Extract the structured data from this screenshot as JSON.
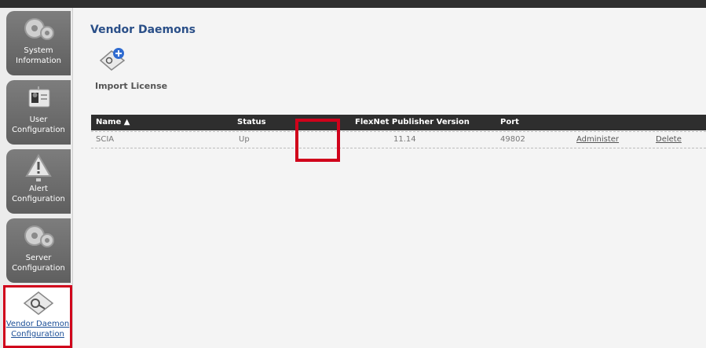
{
  "sidebar": {
    "items": [
      {
        "label": "System Information",
        "icon": "gears-icon"
      },
      {
        "label": "User Configuration",
        "icon": "id-card-icon"
      },
      {
        "label": "Alert Configuration",
        "icon": "warning-icon"
      },
      {
        "label": "Server Configuration",
        "icon": "gears-icon"
      },
      {
        "label": "Vendor Daemon Configuration",
        "icon": "license-key-icon",
        "selected": true
      }
    ]
  },
  "main": {
    "title": "Vendor Daemons",
    "import_label": "Import License",
    "table": {
      "headers": [
        "Name ▲",
        "Status",
        "FlexNet Publisher Version",
        "Port"
      ],
      "rows": [
        {
          "name": "SCIA",
          "status": "Up",
          "version": "11.14",
          "port": "49802",
          "administer": "Administer",
          "delete": "Delete"
        }
      ]
    }
  },
  "colors": {
    "highlight": "#d0021b",
    "title": "#2a4f88",
    "header_bg": "#2e2e2e"
  }
}
